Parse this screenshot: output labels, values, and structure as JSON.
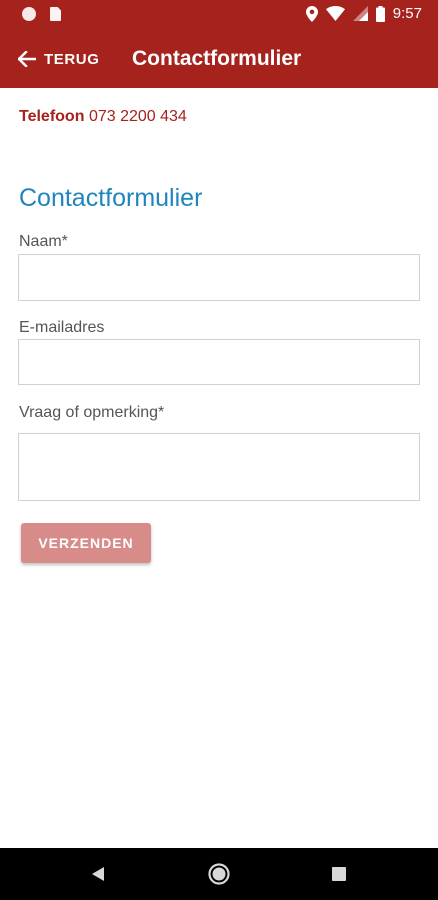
{
  "status_bar": {
    "time": "9:57",
    "icons": [
      "notification-dot-icon",
      "sd-card-icon",
      "location-icon",
      "wifi-icon",
      "signal-icon",
      "battery-icon"
    ]
  },
  "app_bar": {
    "back_label": "TERUG",
    "title": "Contactformulier",
    "color": "#a6221d"
  },
  "contact": {
    "phone_label": "Telefoon",
    "phone_number": "073 2200 434"
  },
  "form": {
    "title": "Contactformulier",
    "fields": [
      {
        "label": "Naam*",
        "value": ""
      },
      {
        "label": "E-mailadres",
        "value": ""
      },
      {
        "label": "Vraag of opmerking*",
        "value": ""
      }
    ],
    "submit_label": "VERZENDEN",
    "title_color": "#1e86bd",
    "button_color": "#d88c8a"
  },
  "nav_bar": {
    "icons": [
      "back-triangle-icon",
      "home-circle-icon",
      "recents-square-icon"
    ]
  }
}
